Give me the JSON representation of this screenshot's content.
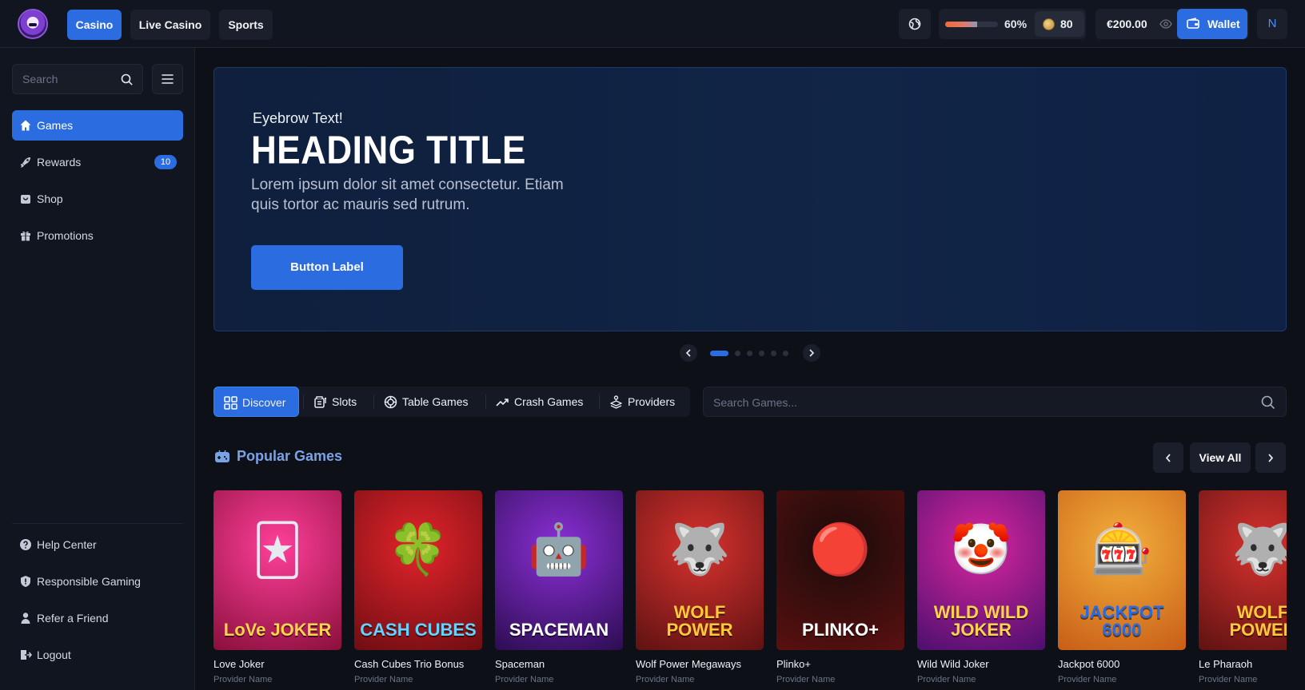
{
  "header": {
    "nav_tabs": [
      {
        "label": "Casino",
        "active": true
      },
      {
        "label": "Live Casino",
        "active": false
      },
      {
        "label": "Sports",
        "active": false
      }
    ],
    "progress_percent": 60,
    "progress_label": "60%",
    "coins": "80",
    "balance": "€200.00",
    "wallet_label": "Wallet",
    "avatar_initial": "N"
  },
  "sidebar": {
    "search_placeholder": "Search",
    "items": [
      {
        "label": "Games",
        "icon": "home-icon",
        "active": true
      },
      {
        "label": "Rewards",
        "icon": "rocket-icon",
        "badge": "10"
      },
      {
        "label": "Shop",
        "icon": "shop-icon"
      },
      {
        "label": "Promotions",
        "icon": "gift-icon"
      }
    ],
    "footer_items": [
      {
        "label": "Help Center",
        "icon": "help-icon"
      },
      {
        "label": "Responsible Gaming",
        "icon": "shield-icon"
      },
      {
        "label": "Refer a Friend",
        "icon": "user-icon"
      },
      {
        "label": "Logout",
        "icon": "logout-icon"
      }
    ]
  },
  "hero": {
    "eyebrow": "Eyebrow Text!",
    "title": "HEADING TITLE",
    "text": "Lorem ipsum dolor sit amet consectetur. Etiam quis tortor ac mauris sed rutrum.",
    "button_label": "Button Label",
    "slide_count": 7,
    "active_slide": 1
  },
  "categories": {
    "tabs": [
      {
        "label": "Discover",
        "icon": "grid-icon",
        "active": true
      },
      {
        "label": "Slots",
        "icon": "slot-machine-icon"
      },
      {
        "label": "Table Games",
        "icon": "chip-icon"
      },
      {
        "label": "Crash Games",
        "icon": "trend-up-icon"
      },
      {
        "label": "Providers",
        "icon": "stack-icon"
      }
    ],
    "search_placeholder": "Search Games..."
  },
  "popular": {
    "title": "Popular Games",
    "icon": "gamepad-icon",
    "view_all_label": "View All",
    "games": [
      {
        "name": "Love Joker",
        "provider": "Provider Name",
        "logo": "LoVe JOKER",
        "glyph": "🃏",
        "bg": [
          "#ff3f9a",
          "#8a0f3c"
        ],
        "logo_color": "#ffd34d"
      },
      {
        "name": "Cash Cubes Trio Bonus",
        "provider": "Provider Name",
        "logo": "CASH CUBES",
        "glyph": "🍀",
        "bg": [
          "#e3242b",
          "#6e0d12"
        ],
        "logo_color": "#63d4ff"
      },
      {
        "name": "Spaceman",
        "provider": "Provider Name",
        "logo": "SPACEMAN",
        "glyph": "🤖",
        "bg": [
          "#8b2fd6",
          "#2c0d52"
        ],
        "logo_color": "#ffffff"
      },
      {
        "name": "Wolf Power Megaways",
        "provider": "Provider Name",
        "logo": "WOLF POWER",
        "glyph": "🐺",
        "bg": [
          "#d8322e",
          "#5e1212"
        ],
        "logo_color": "#ffc93b"
      },
      {
        "name": "Plinko+",
        "provider": "Provider Name",
        "logo": "PLINKO+",
        "glyph": "🔴",
        "bg": [
          "#1a0b0b",
          "#5a1010"
        ],
        "logo_color": "#ffffff"
      },
      {
        "name": "Wild Wild Joker",
        "provider": "Provider Name",
        "logo": "WILD WILD JOKER",
        "glyph": "🤡",
        "bg": [
          "#d9269e",
          "#4b0f6e"
        ],
        "logo_color": "#ffd34d"
      },
      {
        "name": "Jackpot 6000",
        "provider": "Provider Name",
        "logo": "JACKPOT 6000",
        "glyph": "🎰",
        "bg": [
          "#f3b03c",
          "#c85d17"
        ],
        "logo_color": "#2a6be0"
      },
      {
        "name": "Le Pharaoh",
        "provider": "Provider Name",
        "logo": "WOLF POWER",
        "glyph": "🐺",
        "bg": [
          "#d8322e",
          "#5e1212"
        ],
        "logo_color": "#ffc93b"
      }
    ]
  }
}
